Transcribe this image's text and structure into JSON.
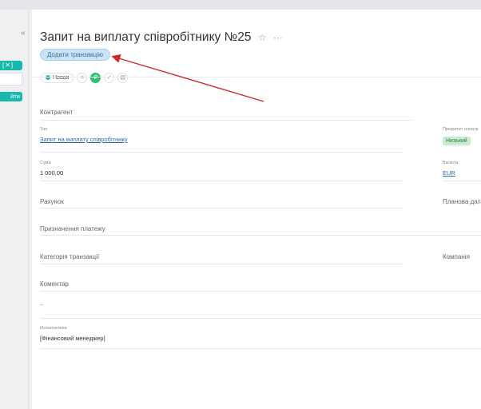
{
  "left_panel": {
    "collapse_icon": "«",
    "teal_label": "[✕] ⋯",
    "button_label": "йти"
  },
  "header": {
    "title": "Запит на виплату співробітнику №25",
    "star_icon": "☆",
    "more_icon": "···",
    "add_transaction_label": "Додати транзакцію"
  },
  "status": {
    "current": "Новая",
    "icons": [
      "list-icon",
      "ruble-icon",
      "check-circle-icon",
      "chat-icon"
    ],
    "glyphs": [
      "≡",
      "₽",
      "✓",
      "▤"
    ]
  },
  "fields": {
    "counterparty_label": "Контрагент",
    "type_label": "Тип",
    "type_value": "Запит на виплату співробітнику",
    "priority_label": "Пріоритет оплати",
    "priority_value": "Низький",
    "sum_label": "Сума",
    "sum_value": "1 000,00",
    "currency_label": "Валюта",
    "currency_value": "EUR",
    "account_label": "Рахунок",
    "planned_date_label": "Планова дата",
    "purpose_label": "Призначення платежу",
    "category_label": "Категорія транзакції",
    "company_label": "Компанія",
    "comment_label": "Коментар",
    "comment_value": "..",
    "performers_label": "Исполнители",
    "performers_value": "[Фінансовий менеджер]"
  },
  "colors": {
    "accent_teal": "#19b8ad",
    "status_green": "#2fbf71",
    "arrow_red": "#d0282e"
  }
}
